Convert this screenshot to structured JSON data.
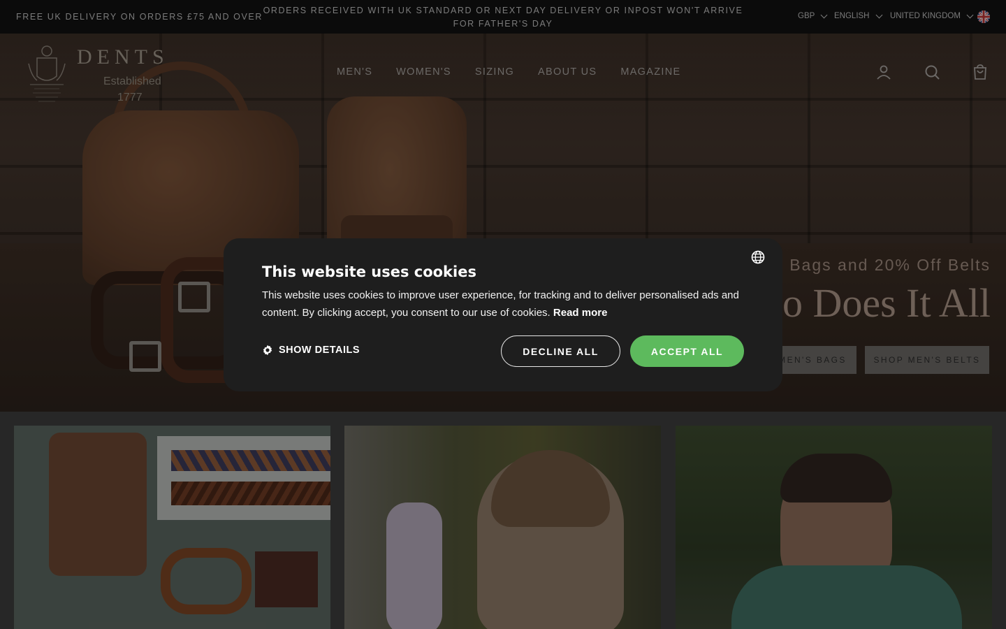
{
  "topbar": {
    "free_delivery": "FREE UK DELIVERY ON ORDERS £75 AND OVER",
    "notice": "ORDERS RECEIVED WITH UK STANDARD OR NEXT DAY DELIVERY OR INPOST WON'T ARRIVE FOR FATHER'S DAY",
    "currency": "GBP",
    "language": "ENGLISH",
    "country": "UNITED KINGDOM"
  },
  "brand": {
    "name": "DENTS",
    "established": "Established",
    "year": "1777"
  },
  "nav": {
    "items": [
      "MEN'S",
      "WOMEN'S",
      "SIZING",
      "ABOUT US",
      "MAGAZINE"
    ]
  },
  "hero": {
    "subtitle": "Bags and 20% Off Belts",
    "title": "o Does It All",
    "btn_bags": "MEN'S BAGS",
    "btn_belts": "SHOP MEN'S BELTS"
  },
  "cookie": {
    "title": "This website uses cookies",
    "body": "This website uses cookies to improve user experience, for tracking and to deliver personalised ads and content. By clicking accept, you consent to our use of cookies.",
    "read_more": "Read more",
    "show_details": "SHOW DETAILS",
    "decline": "DECLINE ALL",
    "accept": "ACCEPT ALL"
  },
  "icons": {
    "account": "user-icon",
    "search": "search-icon",
    "cart": "bag-icon",
    "language": "globe-icon",
    "details": "gear-icon"
  },
  "colors": {
    "accept": "#5dba5d",
    "modal_bg": "#1e1e1e",
    "topbar_bg": "#121212"
  }
}
